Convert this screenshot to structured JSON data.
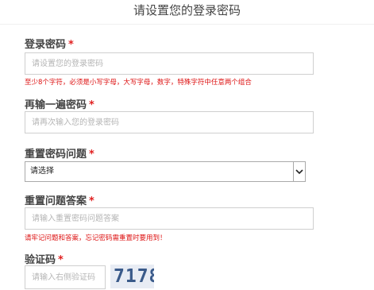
{
  "header": {
    "title": "请设置您的登录密码"
  },
  "form": {
    "required_mark": "*",
    "password": {
      "label": "登录密码",
      "placeholder": "请设置您的登录密码",
      "hint": "至少8个字符，必须是小写字母，大写字母，数字，特殊字符中任意两个组合"
    },
    "confirm_password": {
      "label": "再输一遍密码",
      "placeholder": "请再次输入您的登录密码"
    },
    "reset_question": {
      "label": "重置密码问题",
      "selected": "请选择"
    },
    "reset_answer": {
      "label": "重置问题答案",
      "placeholder": "请输入重置密码问题答案",
      "hint": "请牢记问题和答案，忘记密码需重置时要用到！"
    },
    "captcha": {
      "label": "验证码",
      "placeholder": "请输入右侧验证码",
      "image_text": "7178"
    }
  },
  "colors": {
    "required": "#e02020",
    "hint": "#dd1111"
  }
}
